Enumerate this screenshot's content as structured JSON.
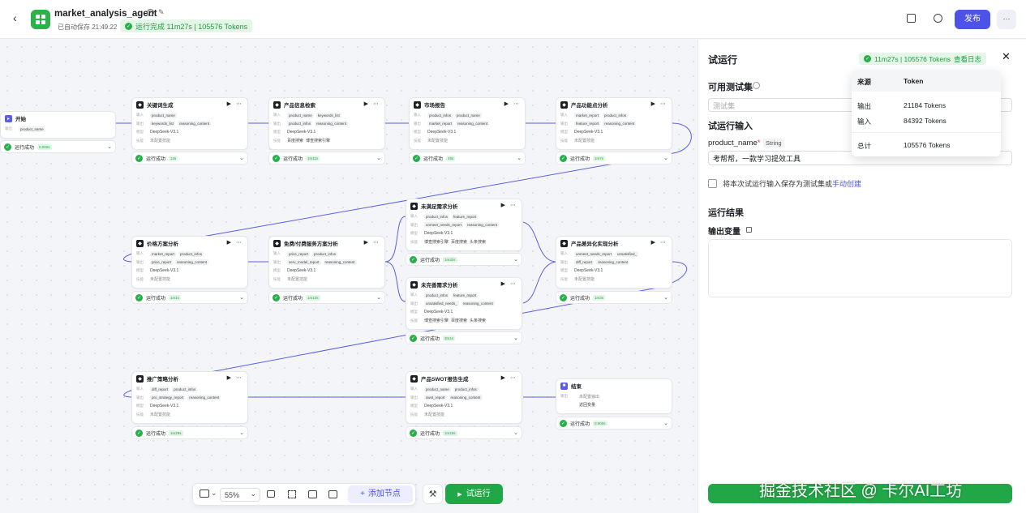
{
  "header": {
    "app_name": "market_analysis_agent",
    "autosave": "已自动保存 21:49:22",
    "run_badge": "运行完成 11m27s | 105576 Tokens",
    "publish": "发布",
    "more": "···"
  },
  "nodes": {
    "start": {
      "title": "开始",
      "f1": "product_name",
      "status": "运行成功",
      "time": "0.000s"
    },
    "kw": {
      "title": "关键词生成",
      "in1": "product_name",
      "out1": "keywords_list",
      "out2": "reasoning_content",
      "model": "DeepSeek-V3.1",
      "skill": "未配置技能",
      "status": "运行成功",
      "time": "14s"
    },
    "info": {
      "title": "产品信息检索",
      "in1": "product_name",
      "in2": "keywords_list",
      "out1": "product_infos",
      "out2": "reasoning_content",
      "model": "DeepSeek-V3.1",
      "t1": "百度搜索",
      "t2": "博查搜索引擎",
      "status": "运行成功",
      "time": "1m11s"
    },
    "market": {
      "title": "市场报告",
      "in1": "product_infos",
      "in2": "product_name",
      "out1": "market_report",
      "out2": "reasoning_content",
      "model": "DeepSeek-V3.1",
      "skill": "未配置技能",
      "status": "运行成功",
      "time": "49s"
    },
    "feature": {
      "title": "产品功能点分析",
      "in1": "market_report",
      "in2": "product_infos",
      "out1": "feature_report",
      "out2": "reasoning_content",
      "model": "DeepSeek-V3.1",
      "skill": "未配置技能",
      "status": "运行成功",
      "time": "1m7s"
    },
    "price": {
      "title": "价格方案分析",
      "in1": "market_report",
      "in2": "product_infos",
      "out1": "price_report",
      "out2": "reasoning_content",
      "model": "DeepSeek-V3.1",
      "skill": "未配置技能",
      "status": "运行成功",
      "time": "1m1s"
    },
    "free": {
      "title": "免费/付费服务方案分析",
      "in1": "price_report",
      "in2": "product_infos",
      "out1": "serv_model_report",
      "out2": "reasoning_content",
      "model": "DeepSeek-V3.1",
      "skill": "未配置技能",
      "status": "运行成功",
      "time": "1m13s"
    },
    "unmet": {
      "title": "未满足需求分析",
      "in1": "product_infos",
      "in2": "feature_report",
      "out1": "unmeet_needs_report",
      "out2": "reasoning_content",
      "model": "DeepSeek-V3.1",
      "t1": "博查搜索引擎",
      "t2": "百度搜索",
      "t3": "头条搜索",
      "status": "运行成功",
      "time": "1m32s"
    },
    "imperfect": {
      "title": "未完善需求分析",
      "in1": "product_infos",
      "in2": "feature_report",
      "out1": "unsatisfied_needs_",
      "out2": "reasoning_content",
      "model": "DeepSeek-V3.1",
      "t1": "博查搜索引擎",
      "t2": "百度搜索",
      "t3": "头条搜索",
      "status": "运行成功",
      "time": "3m1s"
    },
    "diff": {
      "title": "产品差异化实现分析",
      "in1": "unmeet_needs_report",
      "in2": "unsatisfied_",
      "out1": "diff_report",
      "out2": "reasoning_content",
      "model": "DeepSeek-V3.1",
      "skill": "未配置技能",
      "status": "运行成功",
      "time": "1m3s"
    },
    "promo": {
      "title": "推广策略分析",
      "in1": "diff_report",
      "in2": "product_infos",
      "out1": "pro_strategy_report",
      "out2": "reasoning_content",
      "model": "DeepSeek-V3.1",
      "skill": "未配置技能",
      "status": "运行成功",
      "time": "1m29s"
    },
    "swot": {
      "title": "产品SWOT报告生成",
      "in1": "product_name",
      "in2": "product_infos",
      "out1": "swot_report",
      "out2": "reasoning_content",
      "model": "DeepSeek-V3.1",
      "skill": "未配置技能",
      "status": "运行成功",
      "time": "1m19s"
    },
    "end": {
      "title": "结束",
      "out": "未配置输出",
      "mode": "返回变量",
      "status": "运行成功",
      "time": "0.000s"
    }
  },
  "labels": {
    "input": "输入",
    "output": "输出",
    "model": "模型",
    "skill": "技能"
  },
  "toolbar": {
    "zoom": "55%",
    "add_node": "添加节点",
    "test_run": "试运行"
  },
  "panel": {
    "title": "试运行",
    "run_info": "11m27s | 105576 Tokens",
    "view_log": "查看日志",
    "testset_label": "可用测试集",
    "testset_placeholder": "测试集",
    "input_section": "试运行输入",
    "param_name": "product_name",
    "param_type": "String",
    "param_value": "考帮帮，一款学习提效工具",
    "save_text": "将本次试运行输入保存为测试集或",
    "save_link": "手动创建",
    "result_section": "运行结果",
    "output_var": "输出变量"
  },
  "token_popover": {
    "col1": "来源",
    "col2": "Token",
    "rows": [
      {
        "src": "输出",
        "val": "21184 Tokens"
      },
      {
        "src": "输入",
        "val": "84392 Tokens"
      },
      {
        "src": "总计",
        "val": "105576 Tokens"
      }
    ]
  },
  "watermark": "掘金技术社区 @ 卡尔AI工坊",
  "colors": {
    "primary": "#4d53e8",
    "success": "#26b04a",
    "edge": "#5a5fe0"
  }
}
